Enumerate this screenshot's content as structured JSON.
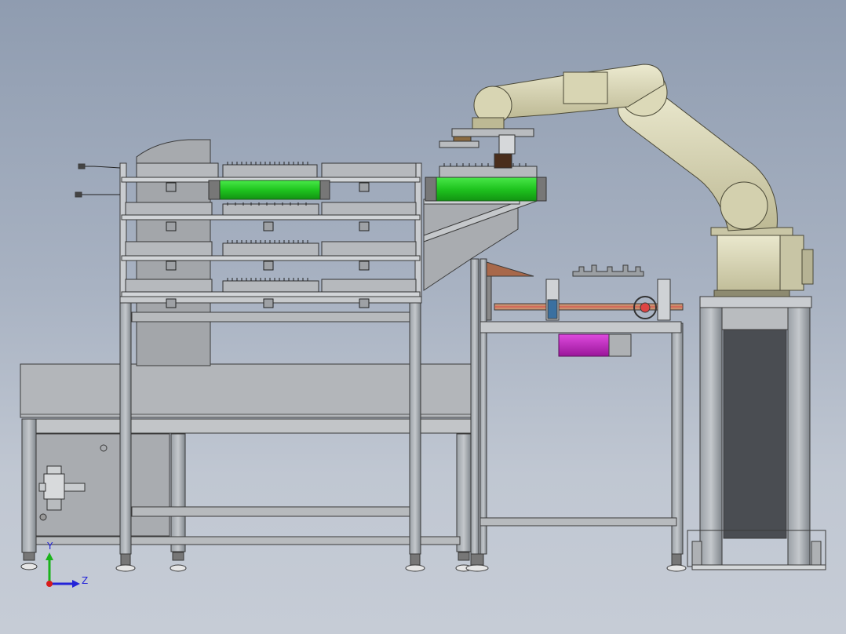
{
  "scene": {
    "description_visible_text": false,
    "palette": {
      "frame_fill": "#b4b8bd",
      "frame_stroke": "#3a3a3a",
      "conveyor_green": "#22cc22",
      "motor_magenta": "#c020c0",
      "robot_beige": "#d9d6b4",
      "robot_shadow": "#a8a585",
      "post_gray": "#8f949a",
      "pad_white": "#e8e8e8",
      "dark_cavity": "#4a4d52"
    }
  },
  "triad": {
    "y_label": "Y",
    "z_label": "Z",
    "y_color": "#1bb31b",
    "z_color": "#2323d8",
    "origin_color": "#d81b1b"
  }
}
